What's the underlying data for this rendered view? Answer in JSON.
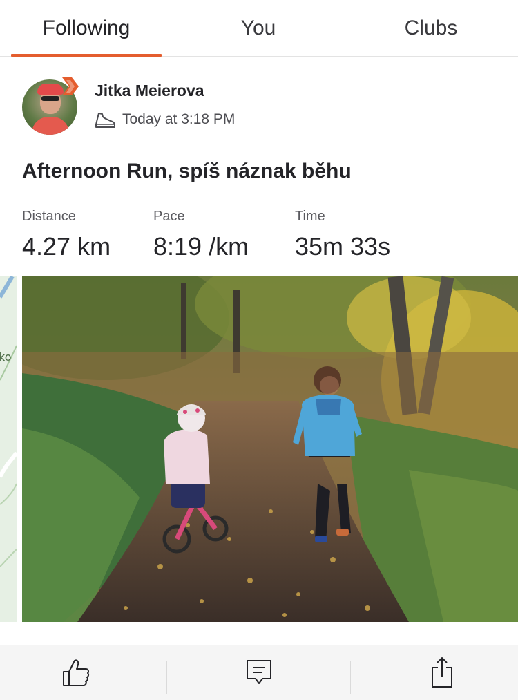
{
  "tabs": [
    {
      "label": "Following",
      "active": true
    },
    {
      "label": "You",
      "active": false
    },
    {
      "label": "Clubs",
      "active": false
    }
  ],
  "accent_color": "#e45d2e",
  "post": {
    "athlete_name": "Jitka Meierova",
    "activity_icon": "shoe-icon",
    "timestamp": "Today at 3:18 PM",
    "title": "Afternoon Run, spíš náznak běhu",
    "stats": [
      {
        "label": "Distance",
        "value": "4.27 km"
      },
      {
        "label": "Pace",
        "value": "8:19 /km"
      },
      {
        "label": "Time",
        "value": "35m 33s"
      }
    ],
    "map_label_fragment": "ko",
    "photo": "children-running-and-biking-on-forest-path"
  },
  "actions": [
    {
      "icon": "thumbs-up-icon"
    },
    {
      "icon": "comment-icon"
    },
    {
      "icon": "share-icon"
    }
  ]
}
